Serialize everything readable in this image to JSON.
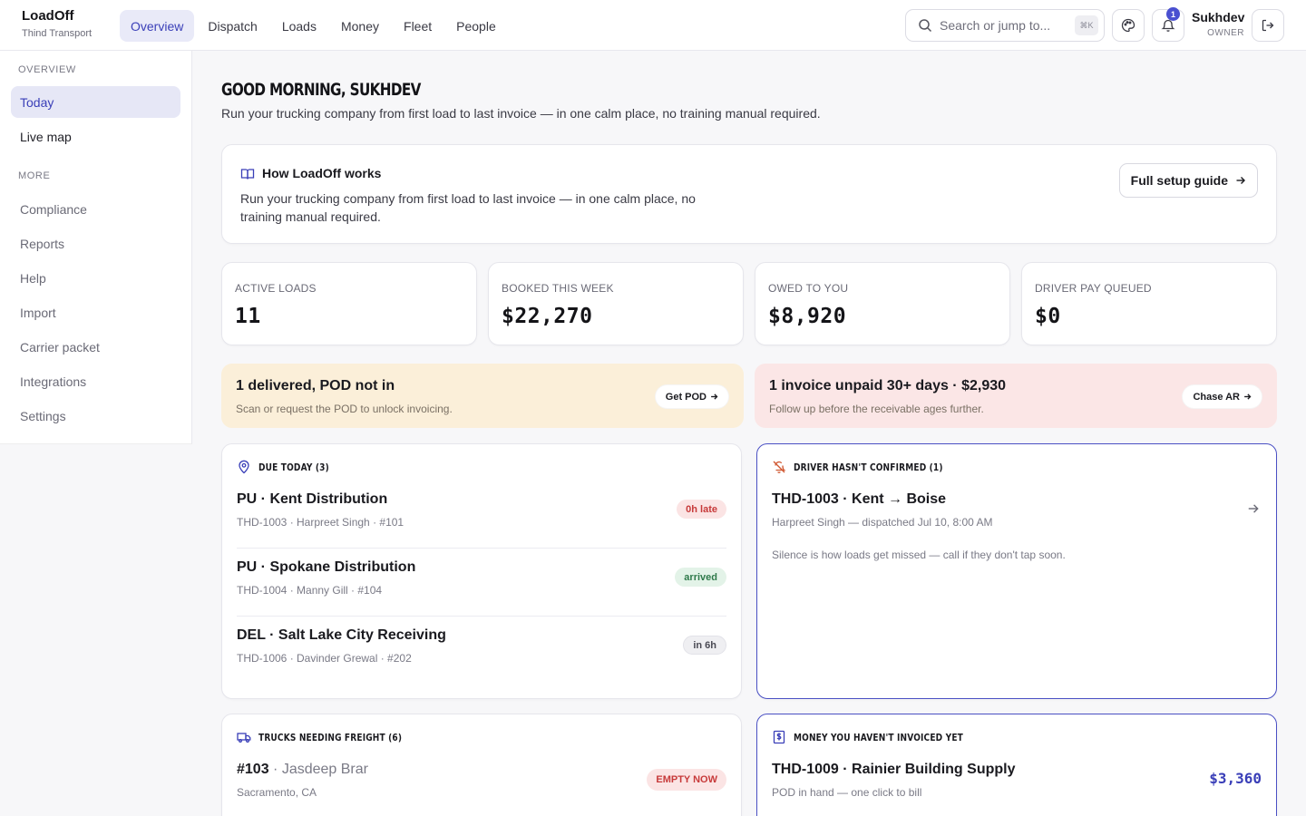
{
  "brand": {
    "name": "LoadOff",
    "company": "Thind Transport"
  },
  "nav": {
    "tabs": [
      {
        "label": "Overview",
        "active": true
      },
      {
        "label": "Dispatch"
      },
      {
        "label": "Loads"
      },
      {
        "label": "Money"
      },
      {
        "label": "Fleet"
      },
      {
        "label": "People"
      }
    ]
  },
  "search": {
    "placeholder": "Search or jump to...",
    "shortcut": "⌘K"
  },
  "notifications": {
    "count": "1"
  },
  "user": {
    "name": "Sukhdev",
    "role": "OWNER"
  },
  "sidebar": {
    "section_overview": "OVERVIEW",
    "section_more": "MORE",
    "items": [
      {
        "label": "Today",
        "active": true
      },
      {
        "label": "Live map"
      },
      {
        "label": "Compliance"
      },
      {
        "label": "Reports"
      },
      {
        "label": "Help"
      },
      {
        "label": "Import"
      },
      {
        "label": "Carrier packet"
      },
      {
        "label": "Integrations"
      },
      {
        "label": "Settings"
      }
    ]
  },
  "greeting": {
    "title": "GOOD MORNING, SUKHDEV",
    "subtitle": "Run your trucking company from first load to last invoice — in one calm place, no training manual required."
  },
  "how": {
    "title": "How LoadOff works",
    "body": "Run your trucking company from first load to last invoice — in one calm place, no training manual required.",
    "button": "Full setup guide"
  },
  "stats": [
    {
      "label": "ACTIVE LOADS",
      "value": "11"
    },
    {
      "label": "BOOKED THIS WEEK",
      "value": "$22,270"
    },
    {
      "label": "OWED TO YOU",
      "value": "$8,920"
    },
    {
      "label": "DRIVER PAY QUEUED",
      "value": "$0"
    }
  ],
  "alerts": [
    {
      "title": "1 delivered, POD not in",
      "subtitle": "Scan or request the POD to unlock invoicing.",
      "button": "Get POD",
      "bg": "#fbefd9"
    },
    {
      "title": "1 invoice unpaid 30+ days · $2,930",
      "subtitle": "Follow up before the receivable ages further.",
      "button": "Chase AR",
      "bg": "#fbe6e6"
    }
  ],
  "due_today": {
    "title": "DUE TODAY (3)",
    "rows": [
      {
        "title": "PU · Kent Distribution",
        "subtitle": "THD-1003 · Harpreet Singh · #101",
        "status": "0h late",
        "status_color": "#c73a3a",
        "status_bg": "#fbe4e4"
      },
      {
        "title": "PU · Spokane Distribution",
        "subtitle": "THD-1004 · Manny Gill · #104",
        "status": "arrived",
        "status_color": "#2f7a4b",
        "status_bg": "#e3f3e8"
      },
      {
        "title": "DEL · Salt Lake City Receiving",
        "subtitle": "THD-1006 · Davinder Grewal · #202",
        "status": "in 6h",
        "status_color": "#4a4a54",
        "status_bg": "#efeff2"
      }
    ]
  },
  "driver_unconfirmed": {
    "title": "DRIVER HASN'T CONFIRMED (1)",
    "row_title": "THD-1003 · Kent → Boise",
    "row_subtitle": "Harpreet Singh — dispatched Jul 10, 8:00 AM",
    "note": "Silence is how loads get missed — call if they don't tap soon."
  },
  "trucks": {
    "title": "TRUCKS NEEDING FREIGHT (6)",
    "row_unit": "#103",
    "row_driver": "· Jasdeep Brar",
    "row_location": "Sacramento, CA",
    "status": "EMPTY NOW"
  },
  "uninvoiced": {
    "title": "MONEY YOU HAVEN'T INVOICED YET",
    "row_title": "THD-1009 · Rainier Building Supply",
    "row_subtitle": "POD in hand — one click to bill",
    "amount": "$3,360"
  },
  "colors": {
    "accent": "#3a3fb8",
    "accent_bg": "#e9eaf8",
    "border": "#e6e6ec"
  }
}
